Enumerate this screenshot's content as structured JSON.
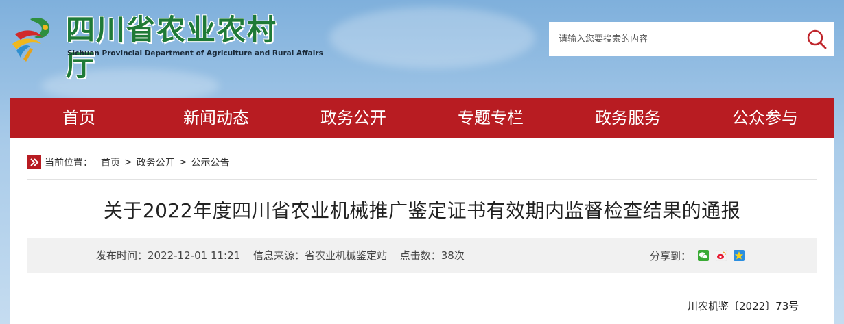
{
  "header": {
    "site_title": "四川省农业农村厅",
    "site_subtitle": "Sichuan Provincial Department of Agriculture and Rural Affairs",
    "logo_icon": "provincial-logo-icon"
  },
  "search": {
    "placeholder": "请输入您要搜索的内容",
    "button_icon": "search-icon"
  },
  "nav": {
    "items": [
      {
        "label": "首页"
      },
      {
        "label": "新闻动态"
      },
      {
        "label": "政务公开"
      },
      {
        "label": "专题专栏"
      },
      {
        "label": "政务服务"
      },
      {
        "label": "公众参与"
      }
    ]
  },
  "breadcrumb": {
    "prefix": "当前位置：",
    "separator": ">",
    "items": [
      "首页",
      "政务公开",
      "公示公告"
    ]
  },
  "article": {
    "title": "关于2022年度四川省农业机械推广鉴定证书有效期内监督检查结果的通报",
    "publish_time": "发布时间：2022-12-01 11:21",
    "source": "信息来源：省农业机械鉴定站",
    "clicks": "点击数：38次",
    "share_label": "分享到：",
    "share_icons": [
      "wechat-icon",
      "weibo-icon",
      "qzone-icon"
    ],
    "doc_number": "川农机鉴〔2022〕73号"
  },
  "colors": {
    "brand_red": "#b81c22",
    "brand_green": "#1f7a37"
  }
}
